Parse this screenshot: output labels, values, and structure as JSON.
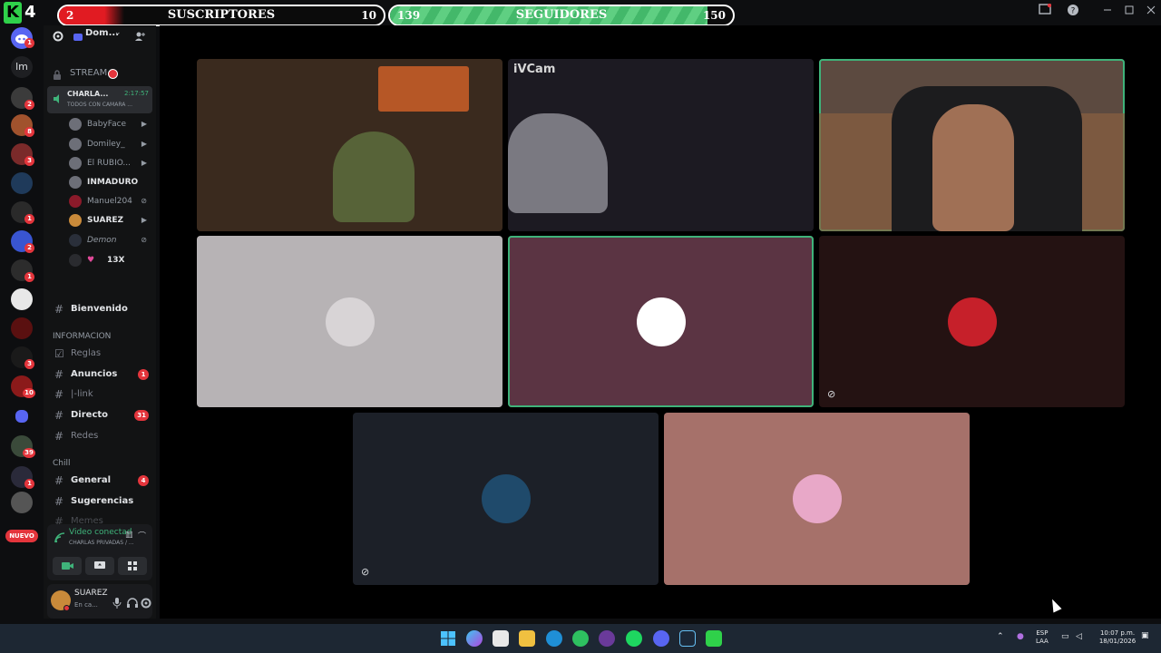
{
  "app": {
    "logo_letter": "K",
    "logo_number": "4"
  },
  "goals": {
    "subscribers": {
      "label": "SUSCRIPTORES",
      "current": "2",
      "max": "10",
      "progress": 0.2
    },
    "followers": {
      "label": "SEGUIDORES",
      "current": "139",
      "max": "150",
      "progress": 0.927
    }
  },
  "server_rail": {
    "dm_label": "lm",
    "badges": [
      "1",
      "2",
      "8",
      "3",
      "1",
      "2",
      "1",
      "3",
      "10",
      "39",
      "1"
    ],
    "new_label": "NUEVO"
  },
  "server_header": {
    "name": "Dom...",
    "icons": [
      "gear-icon",
      "add-friend-icon"
    ]
  },
  "voice_channel": {
    "name": "STREAM",
    "active_channel": "CHARLA...",
    "active_timer": "2:17:57",
    "active_sub": "TODOS CON CAMARA ...",
    "members": [
      {
        "name": "BabyFace",
        "bold": false,
        "icon": "video-icon"
      },
      {
        "name": "Domiley_",
        "bold": false,
        "icon": "video-icon"
      },
      {
        "name": "El RUBIO...",
        "bold": false,
        "icon": "video-icon"
      },
      {
        "name": "INMADURO",
        "bold": true,
        "icon": ""
      },
      {
        "name": "Manuel204",
        "bold": false,
        "icon": "mute-icon"
      },
      {
        "name": "SUAREZ",
        "bold": true,
        "icon": "video-icon"
      },
      {
        "name": "Demon",
        "bold": false,
        "icon": "mute-icon"
      },
      {
        "name": "13X",
        "bold": true,
        "icon": ""
      }
    ]
  },
  "channels": [
    {
      "name": "Bienvenido",
      "bold": true,
      "count": ""
    },
    {
      "name": "INFORMACION",
      "is_category": true
    },
    {
      "name": "Reglas",
      "bold": false,
      "count": ""
    },
    {
      "name": "Anuncios",
      "bold": true,
      "count": "1"
    },
    {
      "name": "|-link",
      "bold": false,
      "count": ""
    },
    {
      "name": "Directo",
      "bold": true,
      "count": "31"
    },
    {
      "name": "Redes",
      "bold": false,
      "count": ""
    },
    {
      "name": "Chill",
      "is_category": true
    },
    {
      "name": "General",
      "bold": true,
      "count": "4"
    },
    {
      "name": "Sugerencias",
      "bold": true,
      "count": ""
    },
    {
      "name": "Memes",
      "bold": false,
      "count": ""
    }
  ],
  "voice_panel": {
    "status": "Video conectad",
    "sub": "CHARLAS PRIVADAS / ..."
  },
  "user_panel": {
    "name": "SUAREZ",
    "status": "En ca..."
  },
  "stage": {
    "tiles": [
      {
        "kind": "camera",
        "label": "",
        "color": "#3a2a1e",
        "speaking": false
      },
      {
        "kind": "camera",
        "label": "iVCam",
        "color": "#1c1a22",
        "speaking": false
      },
      {
        "kind": "camera",
        "label": "",
        "color": "#5c4a40",
        "speaking": true
      },
      {
        "kind": "avatar",
        "label": "",
        "color": "#b7b3b5",
        "avatar_color": "#d8d4d6",
        "speaking": false
      },
      {
        "kind": "avatar",
        "label": "",
        "color": "#5b3443",
        "avatar_color": "#ffffff",
        "speaking": true
      },
      {
        "kind": "avatar",
        "label": "",
        "color": "#241212",
        "avatar_color": "#c6202a",
        "speaking": false,
        "muted": true
      },
      {
        "kind": "avatar",
        "label": "",
        "color": "#1c2028",
        "avatar_color": "#1f4a6b",
        "speaking": false,
        "muted": true
      },
      {
        "kind": "avatar",
        "label": "",
        "color": "#a6716a",
        "avatar_color": "#e8a8c8",
        "speaking": false
      }
    ]
  },
  "taskbar": {
    "tray_lang_1": "ESP",
    "tray_lang_2": "LAA",
    "time": "10:07 p.m.",
    "date": "18/01/2026"
  }
}
